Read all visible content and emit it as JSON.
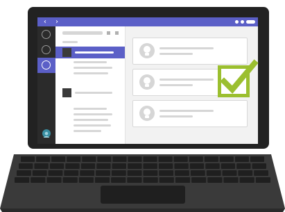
{
  "app": {
    "accent_color": "#5b5fc7",
    "check_color": "#9bbf2f",
    "titlebar": {
      "back_icon": "chevron-left-icon",
      "forward_icon": "chevron-right-icon",
      "back_glyph": "‹",
      "forward_glyph": "›"
    },
    "rail": {
      "icons": [
        "circle-icon",
        "circle-icon",
        "circle-icon"
      ],
      "active_index": 2,
      "user_icon": "avatar-icon"
    },
    "detail": {
      "card_icon": "lightbulb-icon",
      "card_count": 3
    },
    "overlay": {
      "icon": "checkmark-icon"
    }
  }
}
